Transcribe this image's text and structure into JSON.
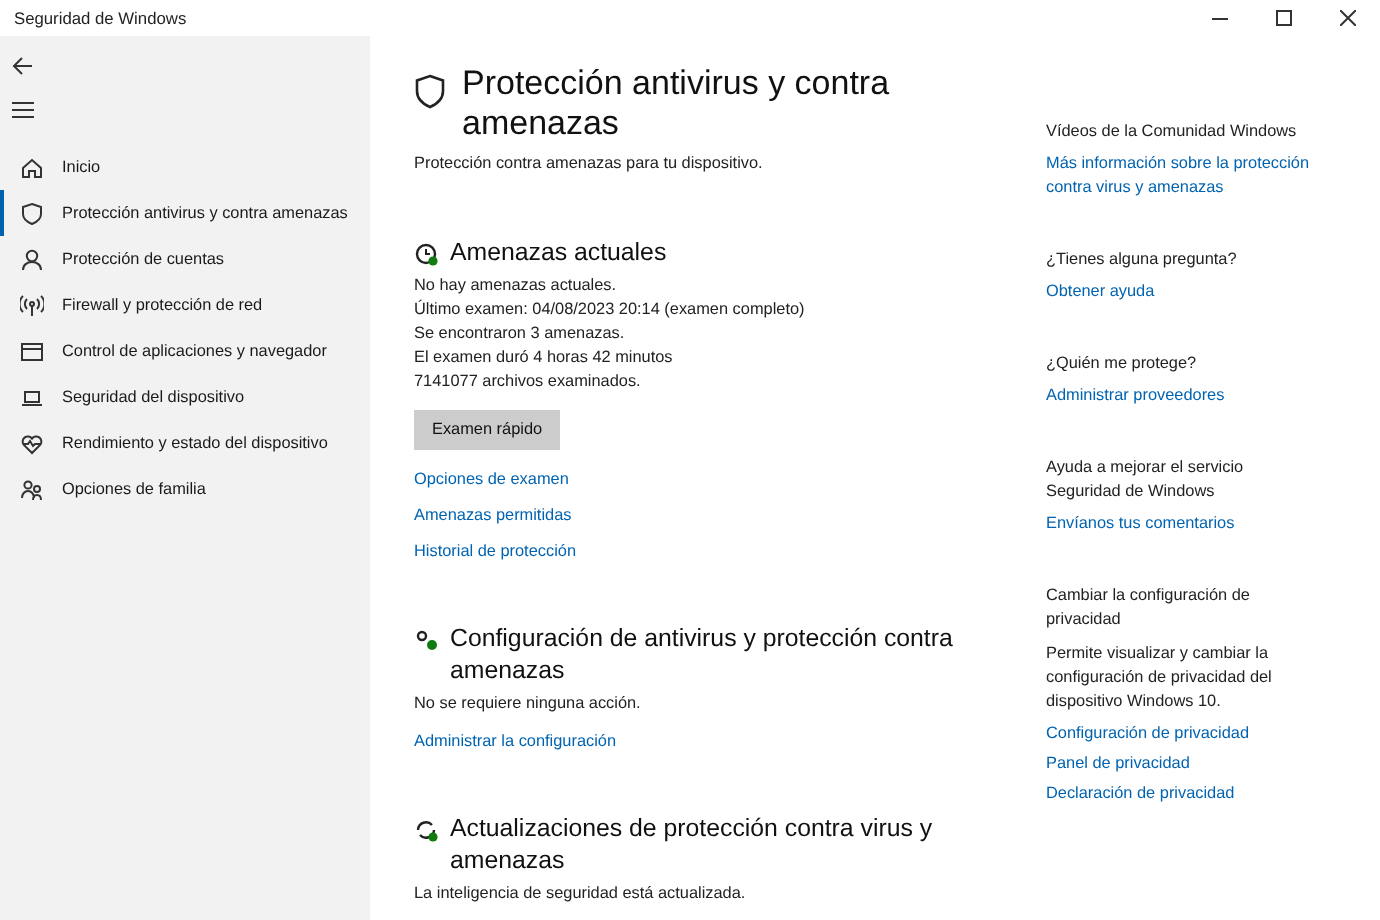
{
  "window": {
    "title": "Seguridad de Windows"
  },
  "sidebar": {
    "items": [
      {
        "label": "Inicio",
        "selected": false
      },
      {
        "label": "Protección antivirus y contra amenazas",
        "selected": true
      },
      {
        "label": "Protección de cuentas",
        "selected": false
      },
      {
        "label": "Firewall y protección de red",
        "selected": false
      },
      {
        "label": "Control de aplicaciones y navegador",
        "selected": false
      },
      {
        "label": "Seguridad del dispositivo",
        "selected": false
      },
      {
        "label": "Rendimiento y estado del dispositivo",
        "selected": false
      },
      {
        "label": "Opciones de familia",
        "selected": false
      }
    ]
  },
  "main": {
    "title": "Protección antivirus y contra amenazas",
    "subtitle": "Protección contra amenazas para tu dispositivo.",
    "sections": [
      {
        "heading": "Amenazas actuales",
        "lines": [
          "No hay amenazas actuales.",
          "Último examen: 04/08/2023 20:14 (examen completo)",
          "Se encontraron 3 amenazas.",
          "El examen duró 4 horas 42 minutos",
          "7141077 archivos examinados."
        ],
        "button": "Examen rápido",
        "links": [
          "Opciones de examen",
          "Amenazas permitidas",
          "Historial de protección"
        ]
      },
      {
        "heading": "Configuración de antivirus y protección contra amenazas",
        "lines": [
          "No se requiere ninguna acción."
        ],
        "links": [
          "Administrar la configuración"
        ]
      },
      {
        "heading": "Actualizaciones de protección contra virus y amenazas",
        "lines": [
          "La inteligencia de seguridad está actualizada."
        ]
      }
    ]
  },
  "aside": {
    "groups": [
      {
        "heading": "Vídeos de la Comunidad Windows",
        "links": [
          "Más información sobre la protección contra virus y amenazas"
        ]
      },
      {
        "heading": "¿Tienes alguna pregunta?",
        "links": [
          "Obtener ayuda"
        ]
      },
      {
        "heading": "¿Quién me protege?",
        "links": [
          "Administrar proveedores"
        ]
      },
      {
        "heading": "Ayuda a mejorar el servicio Seguridad de Windows",
        "links": [
          "Envíanos tus comentarios"
        ]
      },
      {
        "heading": "Cambiar la configuración de privacidad",
        "text": "Permite visualizar y cambiar la configuración de privacidad del dispositivo Windows 10.",
        "links": [
          "Configuración de privacidad",
          "Panel de privacidad",
          "Declaración de privacidad"
        ]
      }
    ]
  }
}
